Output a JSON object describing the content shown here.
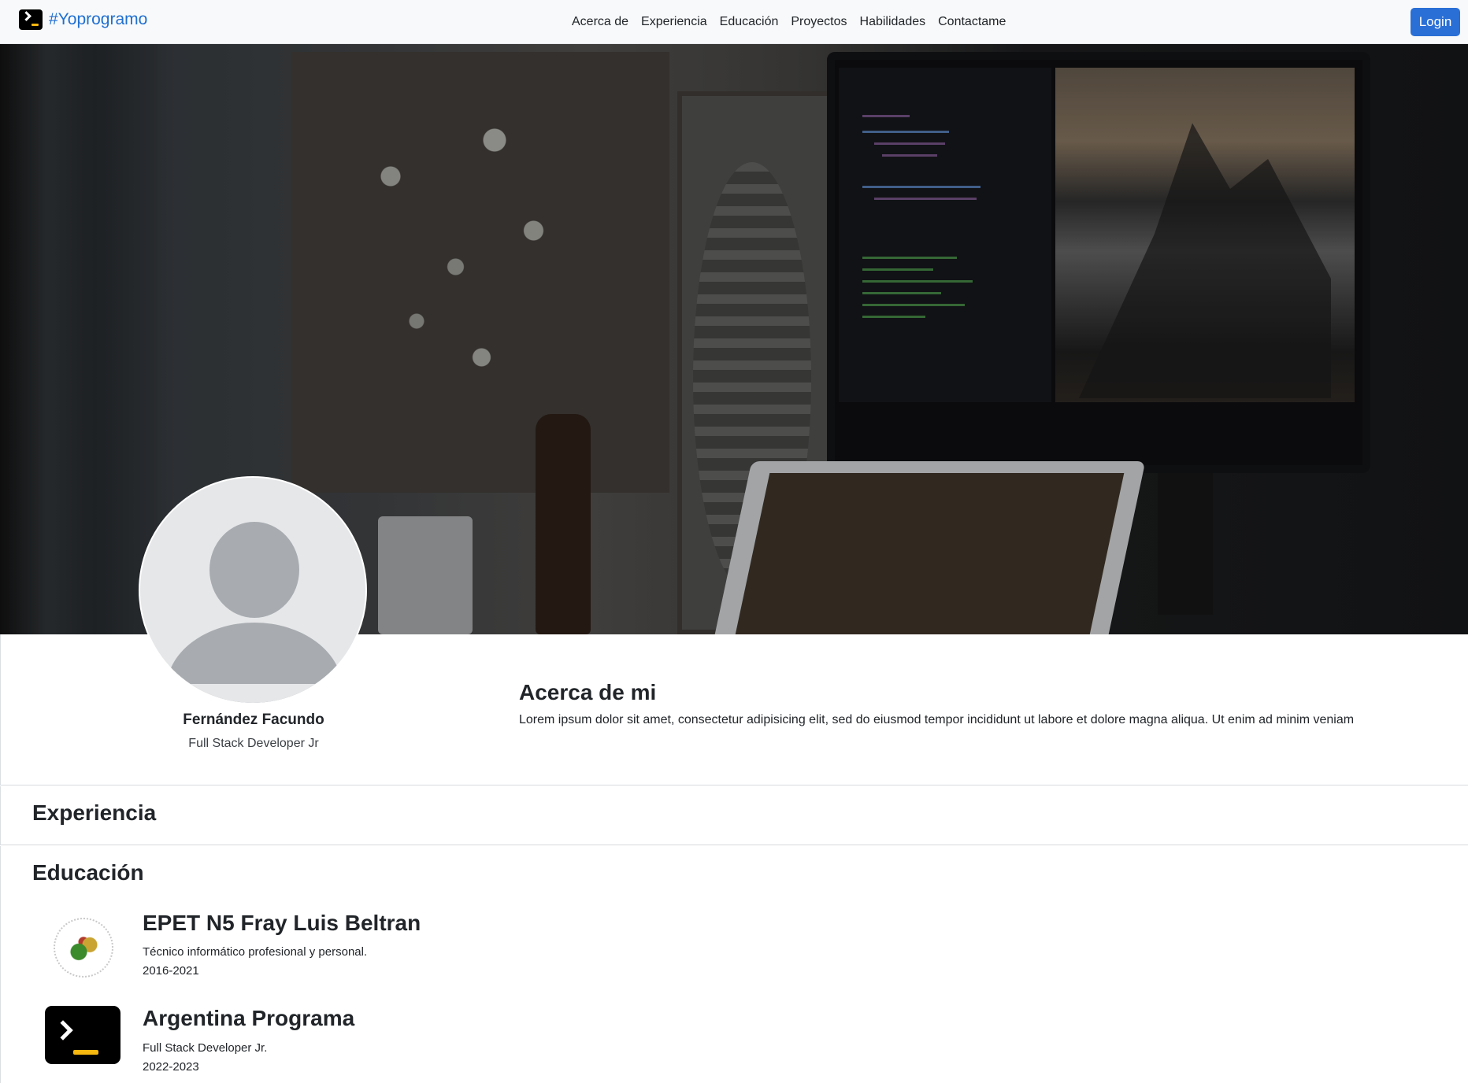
{
  "navbar": {
    "brand_text": "#Yoprogramo",
    "links": [
      "Acerca de",
      "Experiencia",
      "Educación",
      "Proyectos",
      "Habilidades",
      "Contactame"
    ],
    "login_label": "Login"
  },
  "profile": {
    "name": "Fernández Facundo",
    "role": "Full Stack Developer Jr"
  },
  "about": {
    "title": "Acerca de mi",
    "text": "Lorem ipsum dolor sit amet, consectetur adipisicing elit, sed do eiusmod tempor incididunt ut labore et dolore magna aliqua. Ut enim ad minim veniam"
  },
  "experience": {
    "title": "Experiencia"
  },
  "education": {
    "title": "Educación",
    "items": [
      {
        "title": "EPET N5 Fray Luis Beltran",
        "description": "Técnico informático profesional y personal.",
        "years": "2016-2021",
        "logo": "epet-school-seal-icon"
      },
      {
        "title": "Argentina Programa",
        "description": "Full Stack Developer Jr.",
        "years": "2022-2023",
        "logo": "terminal-prompt-icon"
      }
    ]
  },
  "colors": {
    "brand": "#1f6fd1",
    "login_button": "#2a6fd6",
    "navbar_bg": "#f8f9fa",
    "terminal_accent": "#f6b70e"
  }
}
